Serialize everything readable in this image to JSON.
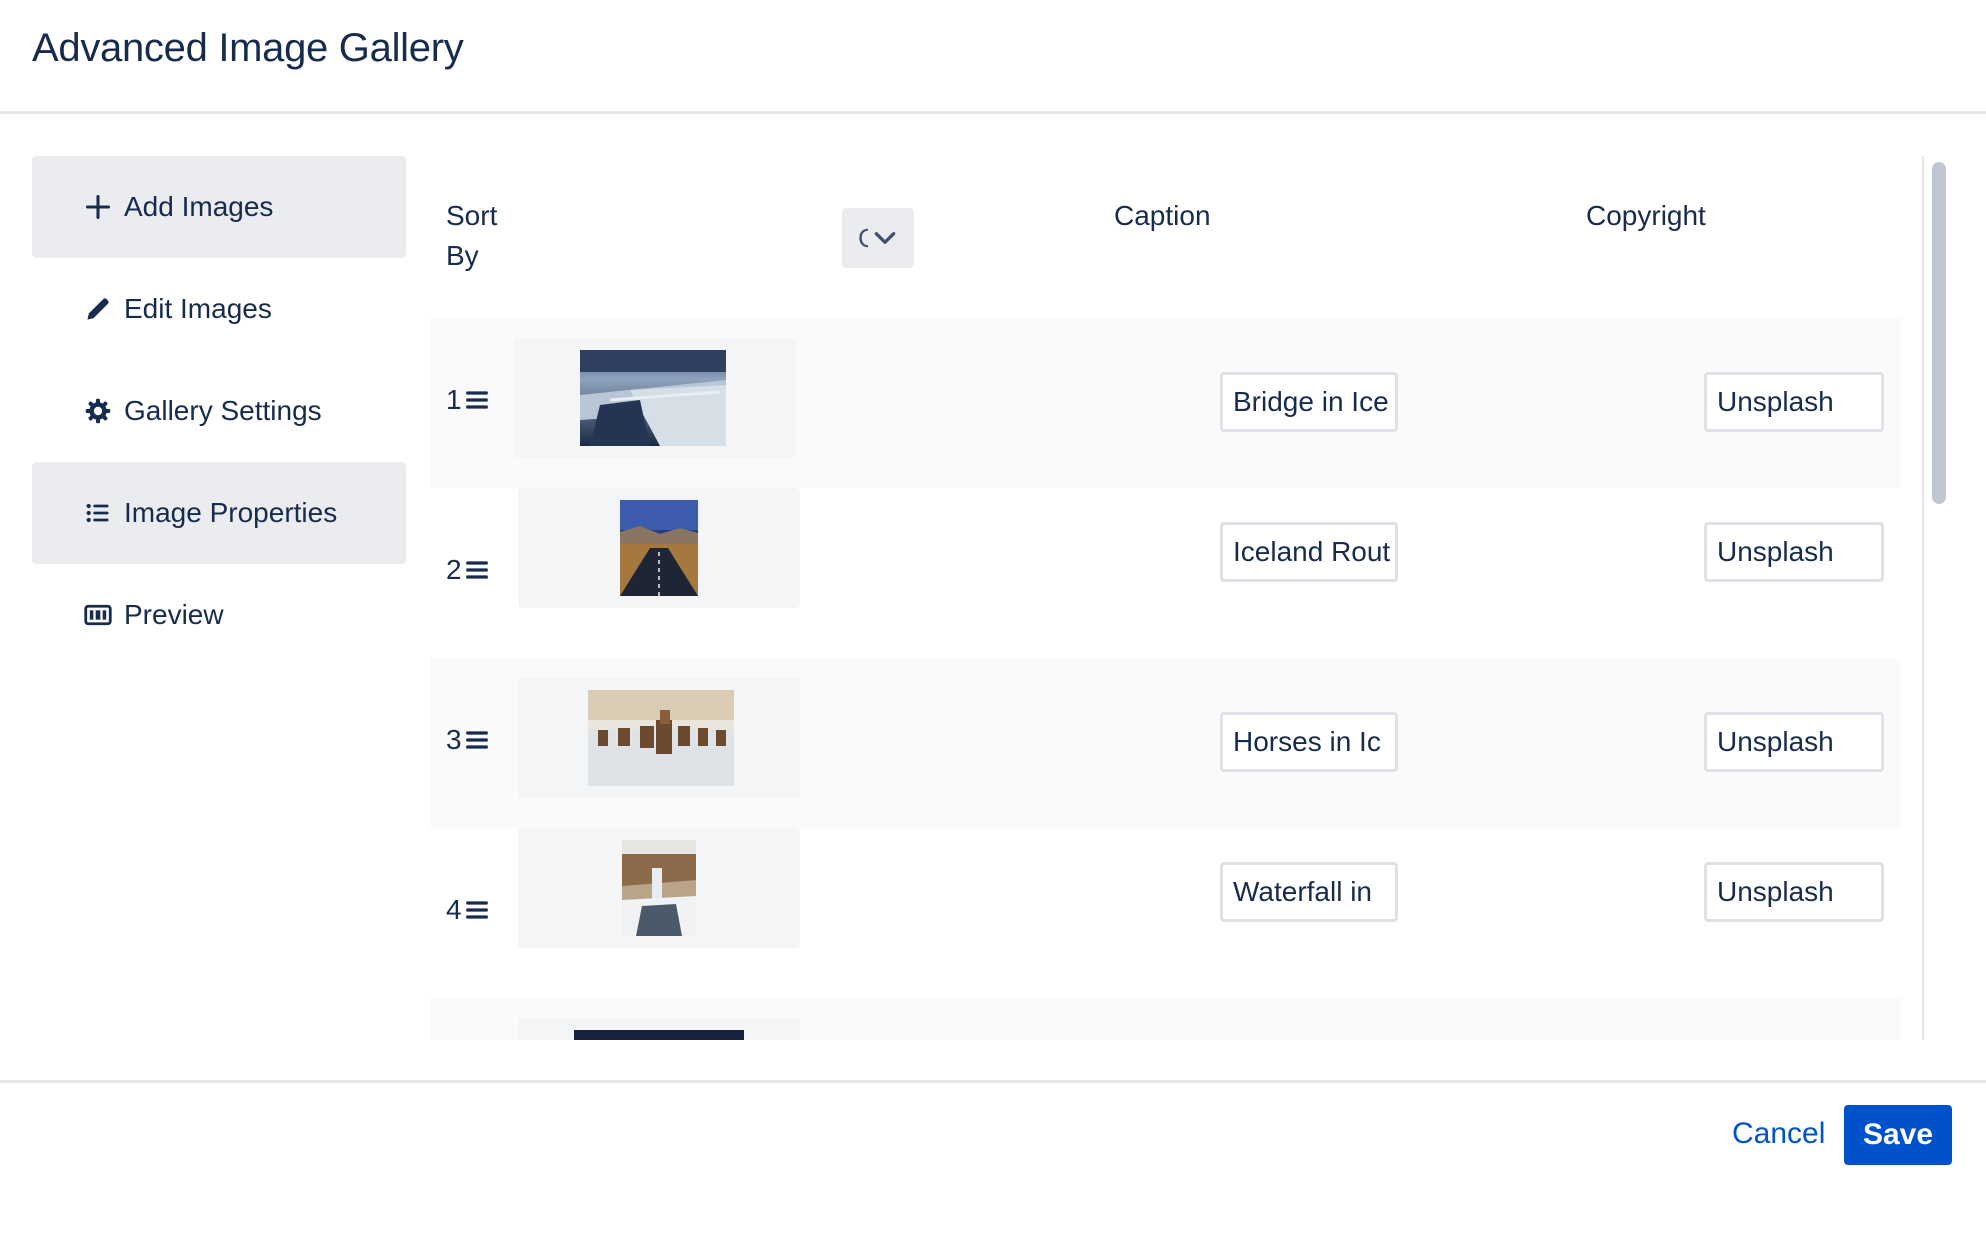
{
  "header": {
    "title": "Advanced Image Gallery"
  },
  "sidebar": {
    "items": [
      {
        "label": "Add Images",
        "icon": "plus-icon",
        "active": true
      },
      {
        "label": "Edit Images",
        "icon": "pencil-icon",
        "active": false
      },
      {
        "label": "Gallery Settings",
        "icon": "gear-icon",
        "active": false
      },
      {
        "label": "Image Properties",
        "icon": "list-icon",
        "active": true
      },
      {
        "label": "Preview",
        "icon": "preview-icon",
        "active": false
      }
    ]
  },
  "table": {
    "sort_label": "Sort By",
    "sort_button_text": "C",
    "caption_header": "Caption",
    "copyright_header": "Copyright",
    "rows": [
      {
        "num": "1",
        "caption": "Bridge in Ice",
        "copyright": "Unsplash",
        "thumb_icon": "bridge-ice-thumbnail"
      },
      {
        "num": "2",
        "caption": "Iceland Rout",
        "copyright": "Unsplash",
        "thumb_icon": "road-thumbnail"
      },
      {
        "num": "3",
        "caption": "Horses in Ic",
        "copyright": "Unsplash",
        "thumb_icon": "horses-thumbnail"
      },
      {
        "num": "4",
        "caption": "Waterfall in",
        "copyright": "Unsplash",
        "thumb_icon": "waterfall-thumbnail"
      }
    ]
  },
  "footer": {
    "cancel_label": "Cancel",
    "save_label": "Save"
  },
  "colors": {
    "accent": "#0052cc",
    "text": "#172b4d",
    "nav_active_bg": "#ebecf0"
  }
}
